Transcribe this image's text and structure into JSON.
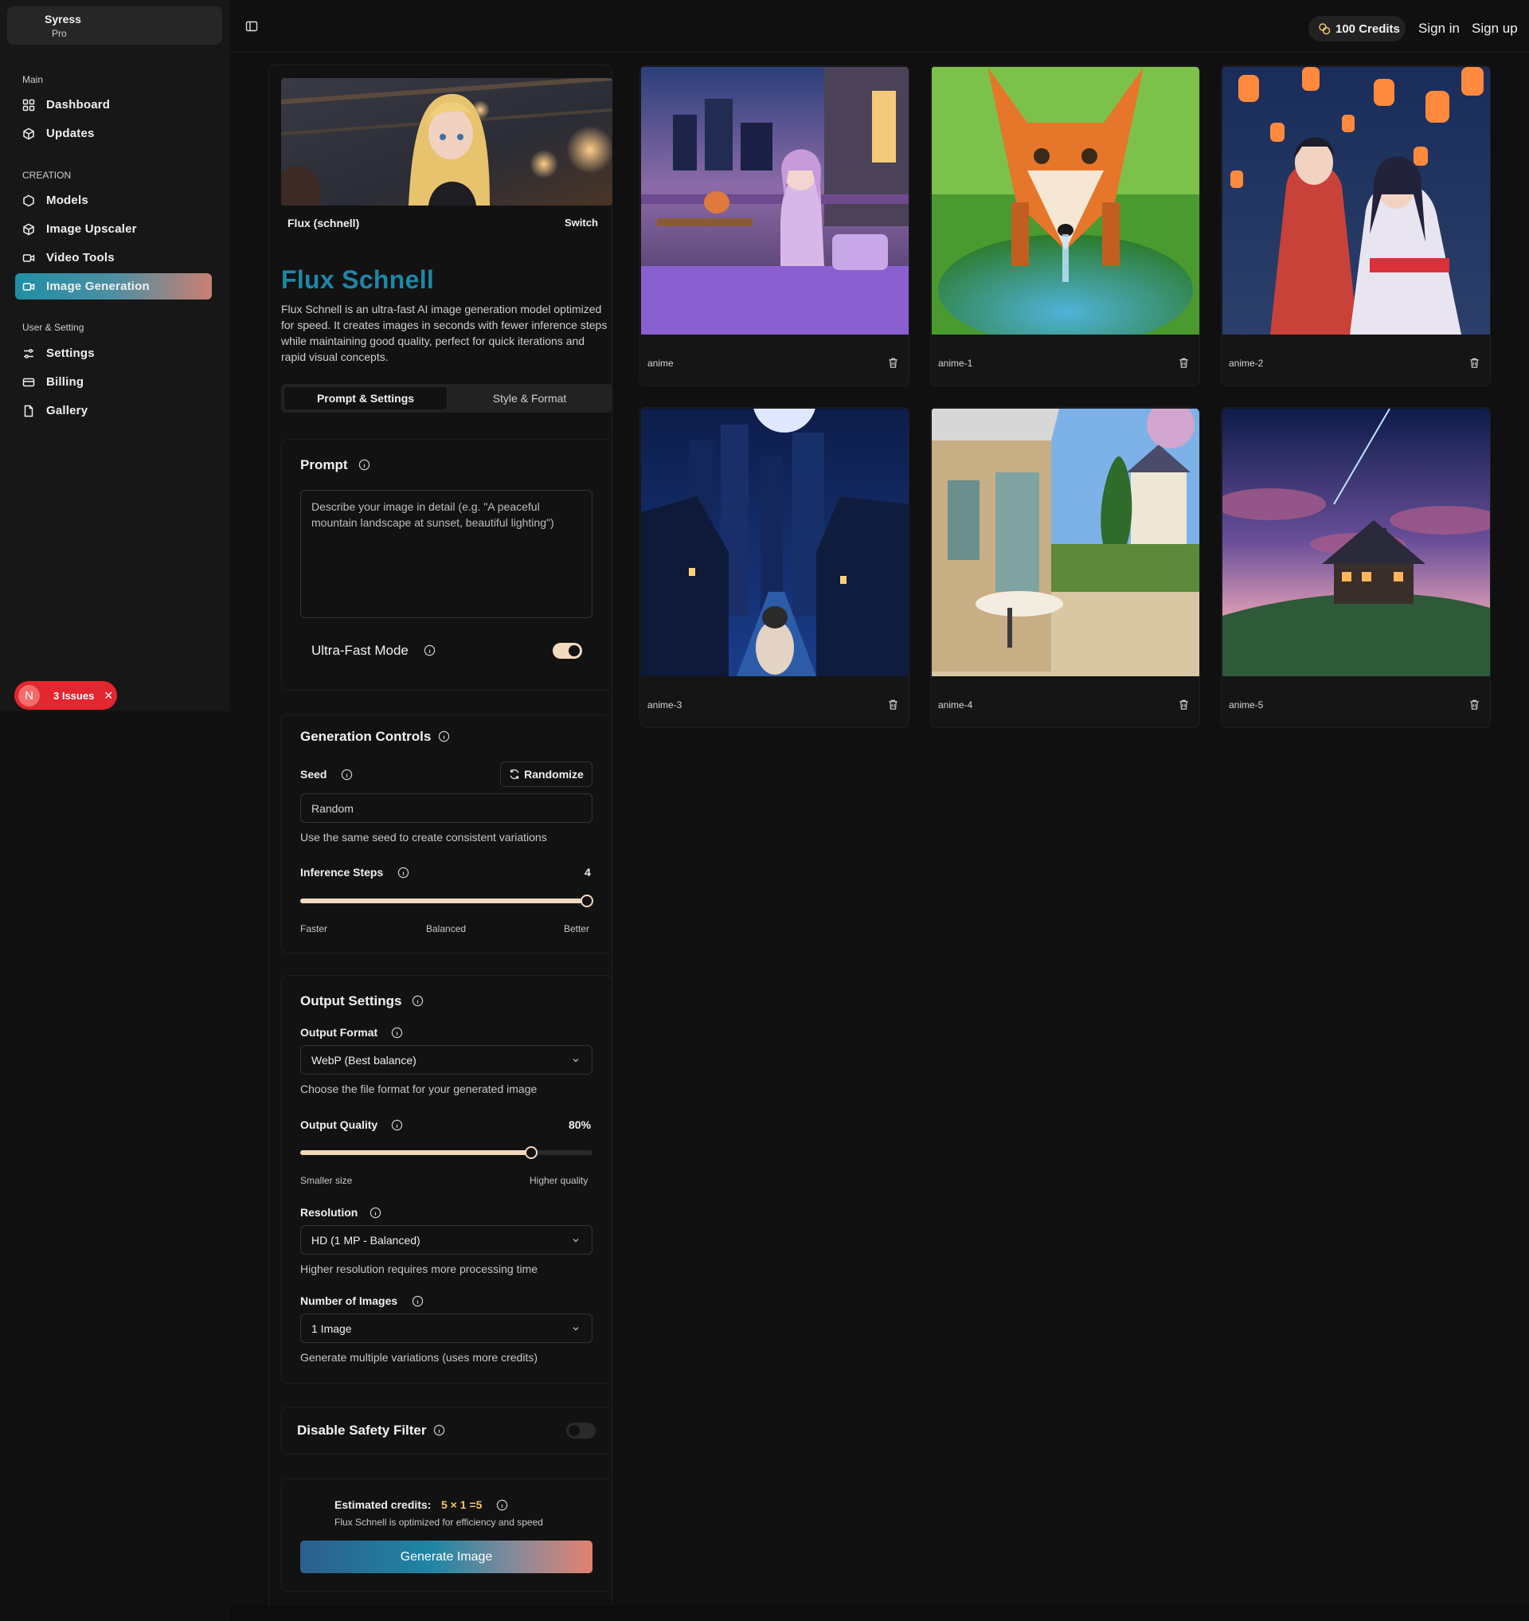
{
  "brand": {
    "name": "Syress",
    "plan": "Pro"
  },
  "sidebar": {
    "sections": [
      {
        "title": "Main",
        "items": [
          {
            "label": "Dashboard",
            "icon": "grid-icon"
          },
          {
            "label": "Updates",
            "icon": "box-icon"
          }
        ]
      },
      {
        "title": "CREATION",
        "items": [
          {
            "label": "Models",
            "icon": "hexagon-icon"
          },
          {
            "label": "Image Upscaler",
            "icon": "box-icon"
          },
          {
            "label": "Video Tools",
            "icon": "video-icon"
          },
          {
            "label": "Image Generation",
            "icon": "video-icon",
            "active": true
          }
        ]
      },
      {
        "title": "User & Setting",
        "items": [
          {
            "label": "Settings",
            "icon": "sliders-icon"
          },
          {
            "label": "Billing",
            "icon": "card-icon"
          },
          {
            "label": "Gallery",
            "icon": "file-icon"
          }
        ]
      }
    ],
    "issues": {
      "avatar": "N",
      "label": "3 Issues"
    }
  },
  "header": {
    "credits": "100 Credits",
    "sign_in": "Sign in",
    "sign_up": "Sign up"
  },
  "model": {
    "name": "Flux (schnell)",
    "switch_label": "Switch",
    "title": "Flux Schnell",
    "description": "Flux Schnell is an ultra-fast AI image generation model optimized for speed. It creates images in seconds with fewer inference steps while maintaining good quality, perfect for quick iterations and rapid visual concepts."
  },
  "tabs": {
    "active": "Prompt & Settings",
    "inactive": "Style & Format"
  },
  "prompt": {
    "title": "Prompt",
    "placeholder": "Describe your image in detail (e.g. \"A peaceful mountain landscape at sunset, beautiful lighting\")",
    "ultra_fast_label": "Ultra-Fast Mode",
    "ultra_fast_on": true
  },
  "generation": {
    "title": "Generation Controls",
    "seed_label": "Seed",
    "randomize_label": "Randomize",
    "seed_value": "Random",
    "seed_hint": "Use the same seed to create consistent variations",
    "steps_label": "Inference Steps",
    "steps_value": "4",
    "steps_fraction": 0.98,
    "steps_marks": {
      "left": "Faster",
      "mid": "Balanced",
      "right": "Better"
    }
  },
  "output": {
    "title": "Output Settings",
    "format_label": "Output Format",
    "format_value": "WebP (Best balance)",
    "format_hint": "Choose the file format for your generated image",
    "quality_label": "Output Quality",
    "quality_value": "80%",
    "quality_fraction": 0.79,
    "quality_marks": {
      "left": "Smaller size",
      "right": "Higher quality"
    },
    "resolution_label": "Resolution",
    "resolution_value": "HD (1 MP - Balanced)",
    "resolution_hint": "Higher resolution requires more processing time",
    "count_label": "Number of Images",
    "count_value": "1 Image",
    "count_hint": "Generate multiple variations (uses more credits)"
  },
  "safety": {
    "label": "Disable Safety Filter",
    "on": false
  },
  "estimate": {
    "label": "Estimated credits:",
    "value": "5 × 1 =5",
    "sub": "Flux Schnell is optimized for efficiency and speed",
    "button": "Generate Image"
  },
  "gallery": [
    {
      "name": "anime",
      "scene": "balcony"
    },
    {
      "name": "anime-1",
      "scene": "fox"
    },
    {
      "name": "anime-2",
      "scene": "lanterns"
    },
    {
      "name": "anime-3",
      "scene": "city-night"
    },
    {
      "name": "anime-4",
      "scene": "cafe"
    },
    {
      "name": "anime-5",
      "scene": "house-sky"
    }
  ],
  "colors": {
    "accent": "#1f86a6",
    "slider": "#f3d9bd",
    "issues": "#e3262f",
    "credits_icon": "#f5c76b"
  }
}
